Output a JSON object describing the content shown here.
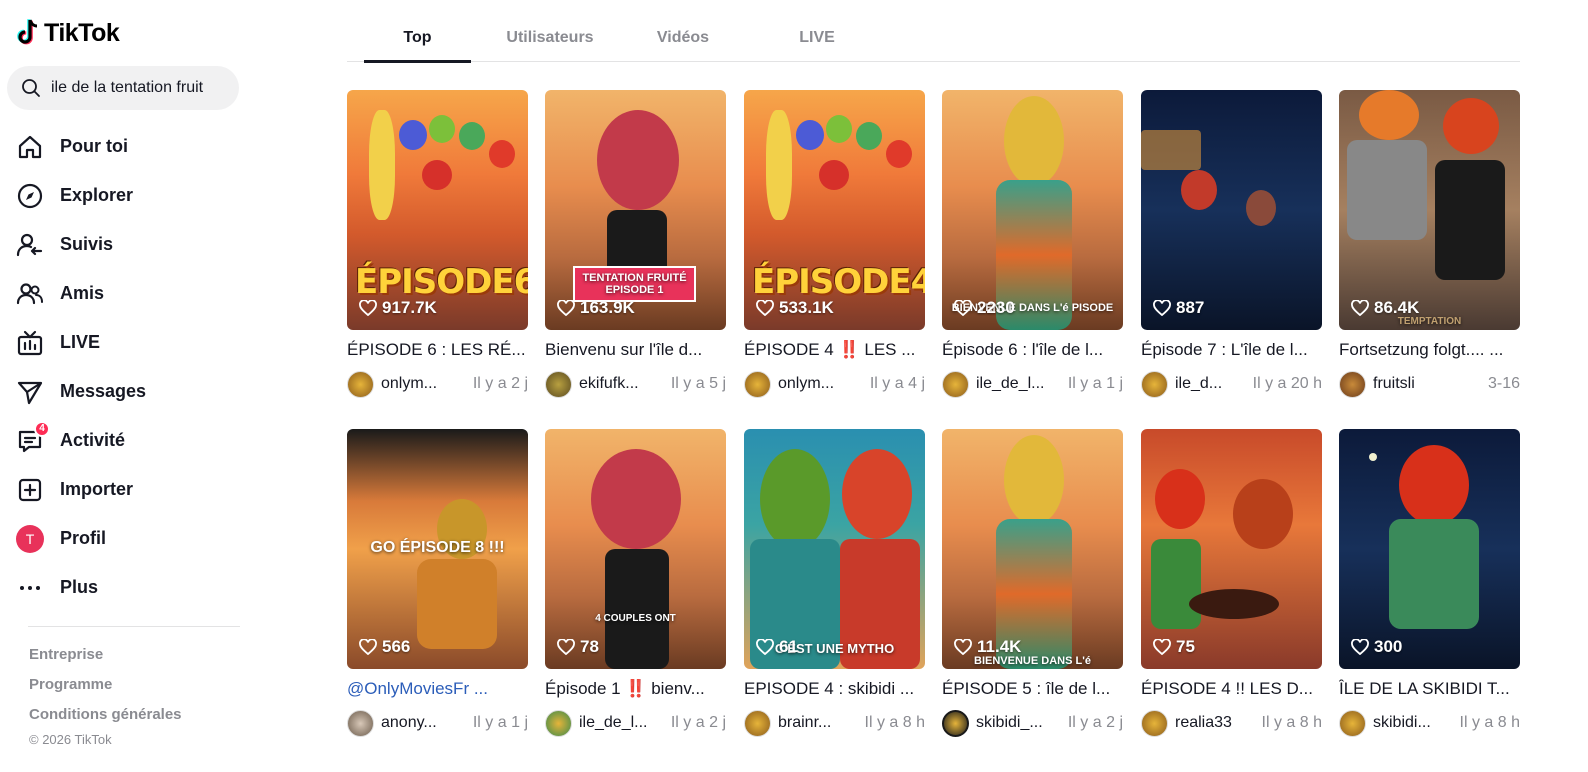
{
  "app": {
    "name": "TikTok"
  },
  "search": {
    "query": "ile de la tentation fruit"
  },
  "nav": [
    {
      "label": "Pour toi",
      "icon": "home-icon"
    },
    {
      "label": "Explorer",
      "icon": "compass-icon"
    },
    {
      "label": "Suivis",
      "icon": "following-icon"
    },
    {
      "label": "Amis",
      "icon": "friends-icon"
    },
    {
      "label": "LIVE",
      "icon": "live-tv-icon"
    },
    {
      "label": "Messages",
      "icon": "send-icon"
    },
    {
      "label": "Activité",
      "icon": "activity-icon",
      "badge": "4"
    },
    {
      "label": "Importer",
      "icon": "upload-plus-icon"
    },
    {
      "label": "Profil",
      "icon": "profile-avatar",
      "avatar_letter": "T"
    },
    {
      "label": "Plus",
      "icon": "more-dots-icon"
    }
  ],
  "footer": {
    "links": [
      "Entreprise",
      "Programme",
      "Conditions générales"
    ],
    "copyright": "© 2026 TikTok"
  },
  "tabs": [
    {
      "label": "Top",
      "active": true
    },
    {
      "label": "Utilisateurs",
      "active": false
    },
    {
      "label": "Vidéos",
      "active": false
    },
    {
      "label": "LIVE",
      "active": false
    }
  ],
  "videos": [
    {
      "likes": "917.7K",
      "title": "ÉPISODE 6 : LES RÉ...",
      "author": "onlym...",
      "time": "Il y a 2 j",
      "overlay": "ÉPISODE6"
    },
    {
      "likes": "163.9K",
      "title": "Bienvenu sur l'île d...",
      "author": "ekifufk...",
      "time": "Il y a 5 j",
      "overlay": "TENTATION FRUITÉ EPISODE 1"
    },
    {
      "likes": "533.1K",
      "title": "ÉPISODE 4 ‼️ LES ...",
      "author": "onlym...",
      "time": "Il y a 4 j",
      "overlay": "ÉPISODE4"
    },
    {
      "likes": "2230",
      "title": "Épisode 6 : l'île de l...",
      "author": "ile_de_l...",
      "time": "Il y a 1 j",
      "overlay": "BIENVENUE DANS L'é PISODE"
    },
    {
      "likes": "887",
      "title": "Épisode 7 : L'île de l...",
      "author": "ile_d...",
      "time": "Il y a 20 h",
      "overlay": ""
    },
    {
      "likes": "86.4K",
      "title": "Fortsetzung folgt.... ...",
      "author": "fruitsli",
      "time": "3-16",
      "overlay": "TEMPTATION"
    },
    {
      "likes": "566",
      "title": "@OnlyMoviesFr ...",
      "author": "anony...",
      "time": "Il y a 1 j",
      "overlay": "GO ÉPISODE 8 !!!",
      "title_is_link": true
    },
    {
      "likes": "78",
      "title": "Épisode 1 ‼️ bienv...",
      "author": "ile_de_l...",
      "time": "Il y a 2 j",
      "overlay": "4 COUPLES ONT"
    },
    {
      "likes": "61",
      "title": "EPISODE 4 : skibidi ...",
      "author": "brainr...",
      "time": "Il y a 8 h",
      "overlay": "C'EST UNE MYTHO"
    },
    {
      "likes": "11.4K",
      "title": "ÉPISODE 5 : île de l...",
      "author": "skibidi_...",
      "time": "Il y a 2 j",
      "overlay": "BIENVENUE DANS L'é"
    },
    {
      "likes": "75",
      "title": "ÉPISODE 4 !! LES D...",
      "author": "realia33",
      "time": "Il y a 8 h",
      "overlay": ""
    },
    {
      "likes": "300",
      "title": "ÎLE DE LA SKIBIDI T...",
      "author": "skibidi...",
      "time": "Il y a 8 h",
      "overlay": ""
    }
  ],
  "colors": {
    "accent": "#fe2c55",
    "text": "#161823",
    "muted": "#8a8b91"
  }
}
